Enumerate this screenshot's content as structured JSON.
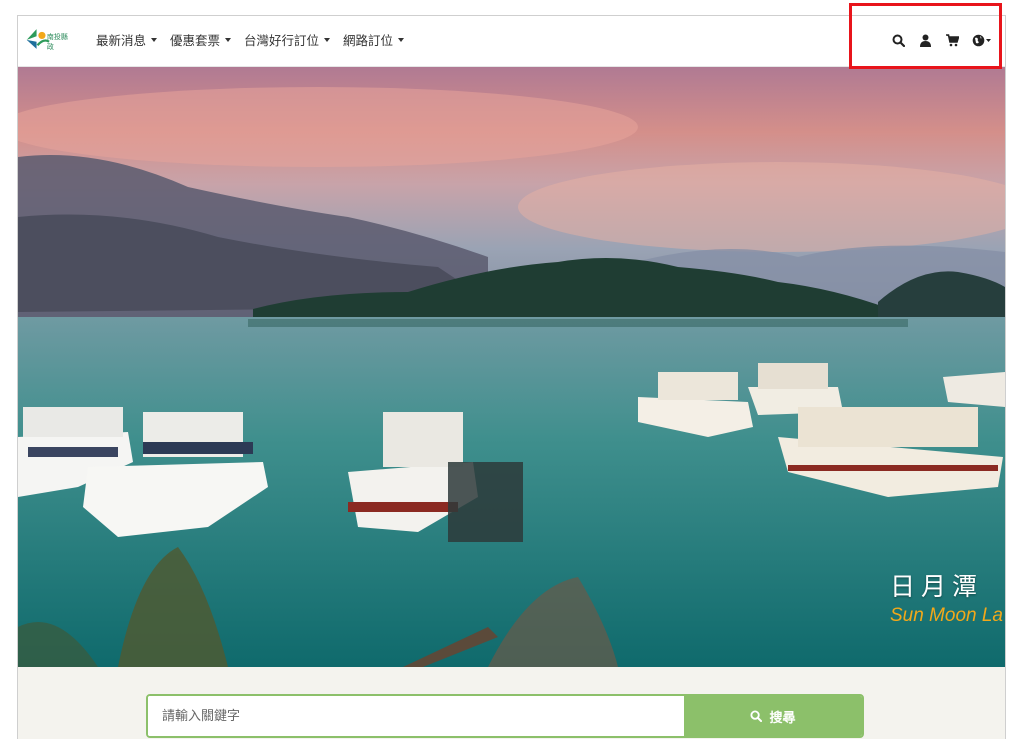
{
  "nav": {
    "logo_text": "南投縣政",
    "menu": [
      {
        "label": "最新消息"
      },
      {
        "label": "優惠套票"
      },
      {
        "label": "台灣好行訂位"
      },
      {
        "label": "網路訂位"
      }
    ],
    "icons": [
      "search-icon",
      "user-icon",
      "cart-icon",
      "globe-icon"
    ]
  },
  "hero": {
    "caption_cn": "日月潭",
    "caption_en": "Sun Moon La"
  },
  "search": {
    "placeholder": "請輸入關鍵字",
    "button_label": "搜尋"
  },
  "colors": {
    "accent_green": "#8cc06a",
    "highlight_red": "#e8141b"
  }
}
